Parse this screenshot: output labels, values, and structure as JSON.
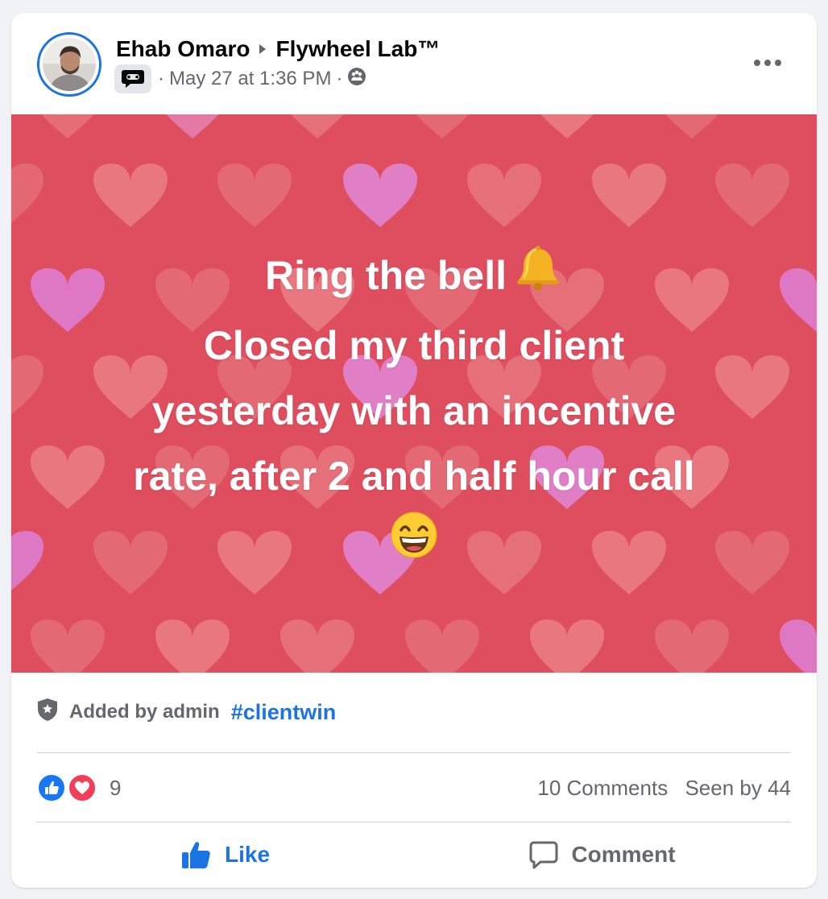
{
  "post": {
    "author": "Ehab Omaro",
    "group": "Flywheel Lab™",
    "timestamp": "May 27 at 1:36 PM",
    "separator": "·",
    "text_lines": [
      "Ring the bell",
      "Closed my third client",
      "yesterday with an incentive",
      "rate, after 2 and half hour call"
    ],
    "emoji_after_line1": "bell",
    "emoji_last_line": "grinning-face",
    "background_color": "#df4e5e",
    "accent_color": "#1b74e4"
  },
  "topic": {
    "added_by": "Added by admin",
    "hashtag": "#clientwin"
  },
  "reactions": {
    "count": "9",
    "comments": "10 Comments",
    "seen_by": "Seen by 44",
    "icons": [
      "like-icon",
      "love-icon"
    ]
  },
  "actions": {
    "like_label": "Like",
    "comment_label": "Comment"
  }
}
